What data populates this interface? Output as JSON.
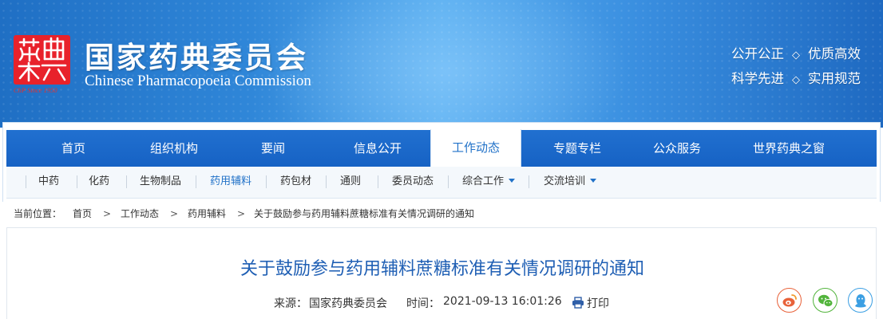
{
  "header": {
    "logo": {
      "seal_text": "藥典",
      "since_text": "ChP Since 1950"
    },
    "title": "国家药典委员会",
    "subtitle": "Chinese Pharmacopoeia Commission",
    "slogans": [
      {
        "left": "公开公正",
        "sep": "◇",
        "right": "优质高效"
      },
      {
        "left": "科学先进",
        "sep": "◇",
        "right": "实用规范"
      }
    ],
    "colors": {
      "gradient_left": "#1f6fc4",
      "gradient_mid": "#59aef0",
      "seal_red": "#e8222b"
    }
  },
  "main_nav": {
    "items": [
      {
        "label": "首页"
      },
      {
        "label": "组织机构"
      },
      {
        "label": "要闻"
      },
      {
        "label": "信息公开"
      },
      {
        "label": "工作动态",
        "active": true
      },
      {
        "label": "专题专栏"
      },
      {
        "label": "公众服务"
      },
      {
        "label": "世界药典之窗"
      }
    ],
    "colors": {
      "bar": "#1a66c8",
      "active_text": "#2272c8"
    }
  },
  "sub_nav": {
    "items": [
      {
        "label": "中药"
      },
      {
        "label": "化药"
      },
      {
        "label": "生物制品"
      },
      {
        "label": "药用辅料",
        "active": true
      },
      {
        "label": "药包材"
      },
      {
        "label": "通则"
      },
      {
        "label": "委员动态"
      },
      {
        "label": "综合工作",
        "has_dropdown": true
      },
      {
        "label": "交流培训",
        "has_dropdown": true
      }
    ]
  },
  "breadcrumb": {
    "prefix": "当前位置：",
    "separator": ">",
    "items": [
      "首页",
      "工作动态",
      "药用辅料",
      "关于鼓励参与药用辅料蔗糖标准有关情况调研的通知"
    ]
  },
  "article": {
    "title": "关于鼓励参与药用辅料蔗糖标准有关情况调研的通知",
    "source_label": "来源：",
    "source": "国家药典委员会",
    "time_label": "时间：",
    "time": "2021-09-13 16:01:26",
    "print_label": "打印",
    "share_icons": [
      "weibo-icon",
      "wechat-icon",
      "qq-icon"
    ],
    "colors": {
      "title": "#1f5fb4"
    }
  }
}
